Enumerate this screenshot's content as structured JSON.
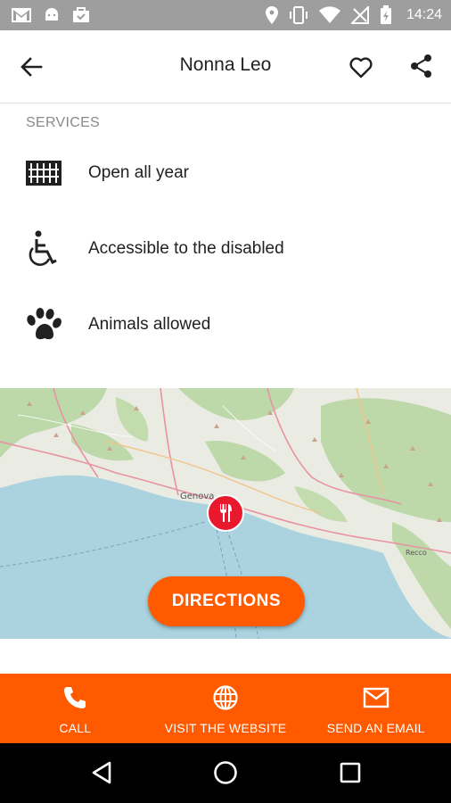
{
  "status_bar": {
    "time": "14:24",
    "background": "#9e9e9e"
  },
  "header": {
    "title": "Nonna Leo",
    "back_icon": "arrow-back-icon",
    "favorite_icon": "heart-outline-icon",
    "share_icon": "share-icon"
  },
  "services": {
    "heading": "SERVICES",
    "items": [
      {
        "icon": "calendar-grid-icon",
        "label": "Open all year"
      },
      {
        "icon": "wheelchair-icon",
        "label": "Accessible to the disabled"
      },
      {
        "icon": "paw-icon",
        "label": "Animals allowed"
      }
    ]
  },
  "map": {
    "city_label": "Genova",
    "town_label": "Recco",
    "pin_icon": "restaurant-icon",
    "directions_label": "DIRECTIONS"
  },
  "actions": [
    {
      "icon": "phone-icon",
      "label": "CALL"
    },
    {
      "icon": "globe-icon",
      "label": "VISIT THE WEBSITE"
    },
    {
      "icon": "mail-icon",
      "label": "SEND AN EMAIL"
    }
  ],
  "colors": {
    "accent": "#ff5a00",
    "pin": "#e8192c",
    "sea": "#aad3df"
  }
}
